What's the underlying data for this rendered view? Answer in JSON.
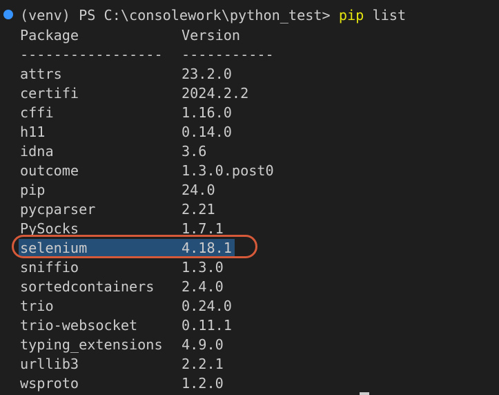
{
  "prompt": {
    "prefix": "(venv) PS C:\\consolework\\python_test> ",
    "command": "pip",
    "args": " list"
  },
  "header": {
    "package": "Package",
    "version": "Version",
    "sep_package": "-----------------",
    "sep_version": "-----------"
  },
  "packages": [
    {
      "name": "attrs",
      "version": "23.2.0"
    },
    {
      "name": "certifi",
      "version": "2024.2.2"
    },
    {
      "name": "cffi",
      "version": "1.16.0"
    },
    {
      "name": "h11",
      "version": "0.14.0"
    },
    {
      "name": "idna",
      "version": "3.6"
    },
    {
      "name": "outcome",
      "version": "1.3.0.post0"
    },
    {
      "name": "pip",
      "version": "24.0"
    },
    {
      "name": "pycparser",
      "version": "2.21"
    },
    {
      "name": "PySocks",
      "version": "1.7.1"
    },
    {
      "name": "selenium",
      "version": "4.18.1"
    },
    {
      "name": "sniffio",
      "version": "1.3.0"
    },
    {
      "name": "sortedcontainers",
      "version": "2.4.0"
    },
    {
      "name": "trio",
      "version": "0.24.0"
    },
    {
      "name": "trio-websocket",
      "version": "0.11.1"
    },
    {
      "name": "typing_extensions",
      "version": "4.9.0"
    },
    {
      "name": "urllib3",
      "version": "2.2.1"
    },
    {
      "name": "wsproto",
      "version": "1.2.0"
    }
  ],
  "highlighted_package": "selenium",
  "colors": {
    "background": "#1e1e1e",
    "text": "#cccccc",
    "command": "#e5e510",
    "selection": "#264f78",
    "annotation": "#d65a3a",
    "status_dot": "#3794ff"
  },
  "icons": {
    "status_dot": "terminal-status-dot-icon"
  }
}
